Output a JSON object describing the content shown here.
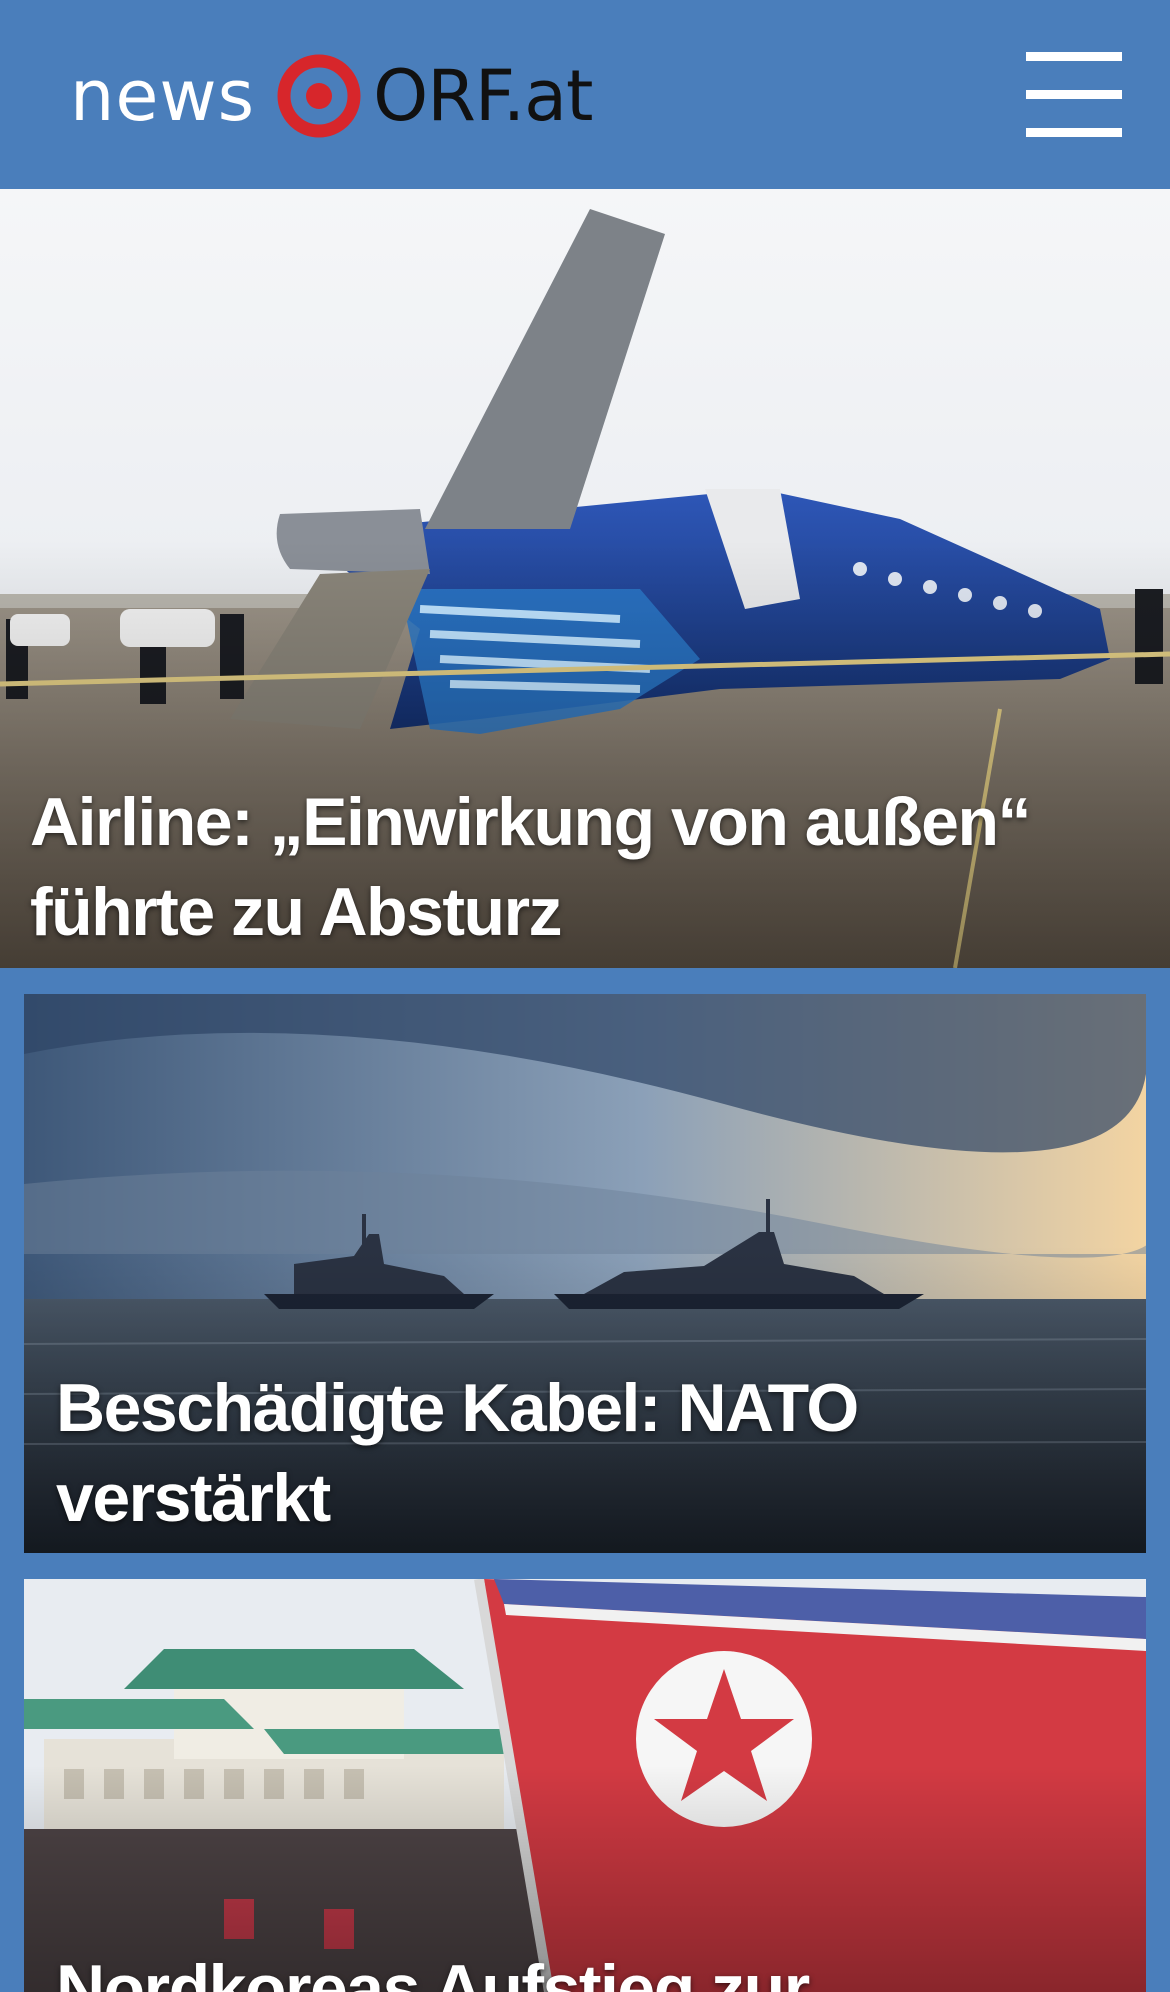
{
  "header": {
    "logo_news": "news",
    "logo_orf": "ORF.at",
    "menu_label": "Menü"
  },
  "colors": {
    "brand": "#4a7ebb",
    "logo_red": "#d7262b"
  },
  "icons": {
    "logo_mark": "orf-ring-icon",
    "menu": "hamburger-menu-icon"
  },
  "stories": [
    {
      "headline": "Airline: „Einwirkung von außen“\nführte zu Absturz",
      "image": "crashed-airliner-photo"
    },
    {
      "headline": "Beschädigte Kabel: NATO verstärkt\nMilitärpräsenz in Ostsee",
      "image": "warships-at-sea-photo"
    },
    {
      "headline": "Nordkoreas Aufstieg zur",
      "image": "north-korean-flag-rally-photo"
    }
  ]
}
